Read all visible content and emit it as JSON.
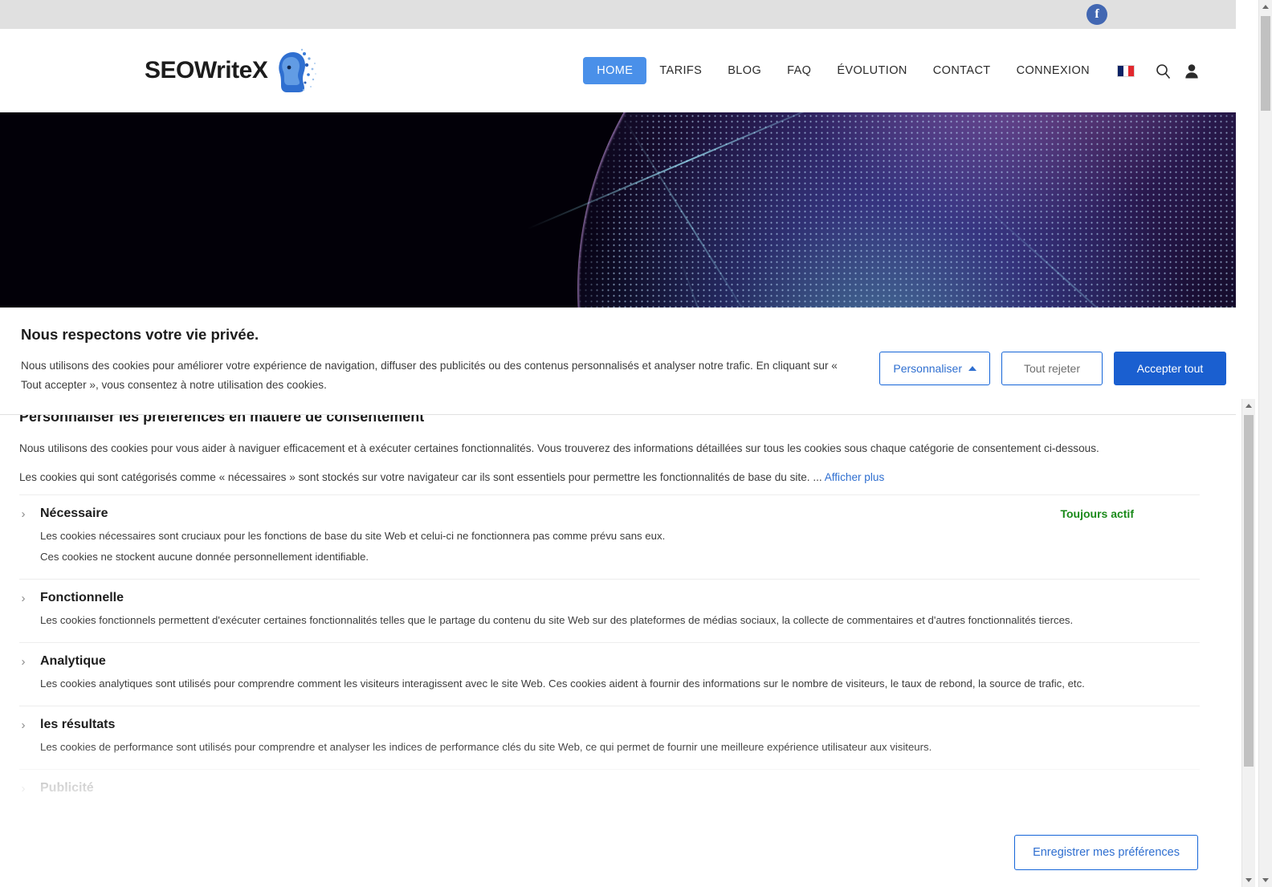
{
  "topbar": {
    "social_icon": "facebook-icon",
    "social_label": "f"
  },
  "header": {
    "logo_text": "SEOWriteX",
    "logo_mark": "ai-robot-head-icon",
    "nav": [
      {
        "label": "HOME",
        "active": true
      },
      {
        "label": "TARIFS",
        "active": false
      },
      {
        "label": "BLOG",
        "active": false
      },
      {
        "label": "FAQ",
        "active": false
      },
      {
        "label": "ÉVOLUTION",
        "active": false
      },
      {
        "label": "CONTACT",
        "active": false
      },
      {
        "label": "CONNEXION",
        "active": false
      }
    ],
    "language_flag": "france-flag-icon",
    "search_icon": "search-icon",
    "account_icon": "user-account-icon",
    "accent_color": "#4a90e9"
  },
  "hero": {
    "alt": "digital-globe-banner"
  },
  "consent": {
    "title": "Nous respectons votre vie privée.",
    "body": "Nous utilisons des cookies pour améliorer votre expérience de navigation, diffuser des publicités ou des contenus personnalisés et analyser notre trafic. En cliquant sur « Tout accepter », vous consentez à notre utilisation des cookies.",
    "customize_label": "Personnaliser",
    "reject_label": "Tout rejeter",
    "accept_label": "Accepter tout"
  },
  "prefs": {
    "title": "Personnaliser les préférences en matière de consentement",
    "intro1": "Nous utilisons des cookies pour vous aider à naviguer efficacement et à exécuter certaines fonctionnalités. Vous trouverez des informations détaillées sur tous les cookies sous chaque catégorie de consentement ci-dessous.",
    "intro2": "Les cookies qui sont catégorisés comme « nécessaires » sont stockés sur votre navigateur car ils sont essentiels pour permettre les fonctionnalités de base du site. ...",
    "show_more_label": "Afficher plus",
    "always_active_label": "Toujours actif",
    "always_active_color": "#1a8a1a",
    "categories": [
      {
        "name": "Nécessaire",
        "desc1": "Les cookies nécessaires sont cruciaux pour les fonctions de base du site Web et celui-ci ne fonctionnera pas comme prévu sans eux.",
        "desc2": "Ces cookies ne stockent aucune donnée personnellement identifiable."
      },
      {
        "name": "Fonctionnelle",
        "desc1": "Les cookies fonctionnels permettent d'exécuter certaines fonctionnalités telles que le partage du contenu du site Web sur des plateformes de médias sociaux, la collecte de commentaires et d'autres fonctionnalités tierces.",
        "desc2": ""
      },
      {
        "name": "Analytique",
        "desc1": "Les cookies analytiques sont utilisés pour comprendre comment les visiteurs interagissent avec le site Web. Ces cookies aident à fournir des informations sur le nombre de visiteurs, le taux de rebond, la source de trafic, etc.",
        "desc2": ""
      },
      {
        "name": "les résultats",
        "desc1": "Les cookies de performance sont utilisés pour comprendre et analyser les indices de performance clés du site Web, ce qui permet de fournir une meilleure expérience utilisateur aux visiteurs.",
        "desc2": ""
      },
      {
        "name": "Publicité",
        "desc1": "",
        "desc2": ""
      }
    ],
    "save_label": "Enregistrer mes préférences"
  }
}
